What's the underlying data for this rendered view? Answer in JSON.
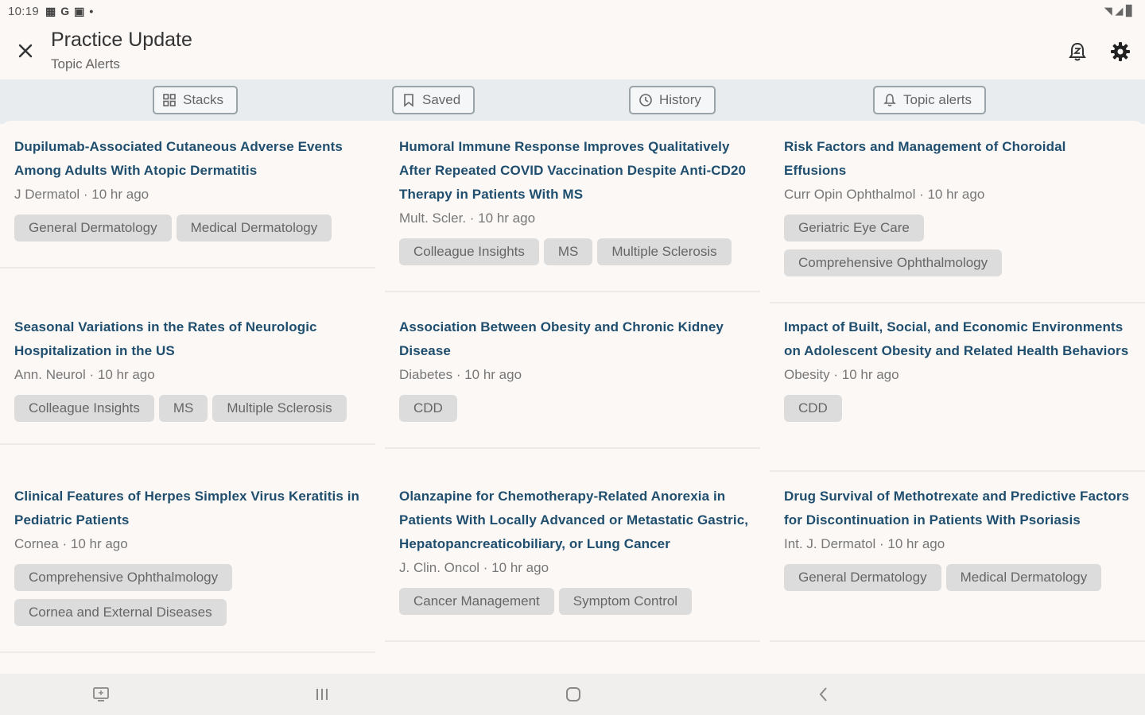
{
  "status_bar": {
    "time": "10:19",
    "icons": [
      "▦",
      "G",
      "▣",
      "•"
    ],
    "right_icons": "◥ ◢ ▊"
  },
  "app_bar": {
    "title": "Practice Update",
    "subtitle": "Topic Alerts",
    "close_icon": "close-icon",
    "bell_icon": "bell-snooze-icon",
    "gear_icon": "gear-icon"
  },
  "tabs": [
    {
      "label": "Stacks",
      "icon": "grid-icon"
    },
    {
      "label": "Saved",
      "icon": "bookmark-icon"
    },
    {
      "label": "History",
      "icon": "clock-icon"
    },
    {
      "label": "Topic alerts",
      "icon": "bell-icon"
    }
  ],
  "articles": {
    "col1": [
      {
        "title": "Dupilumab-Associated Cutaneous Adverse Events Among Adults With Atopic Dermatitis",
        "meta": "J Dermatol · 10 hr ago",
        "tags": [
          "General Dermatology",
          "Medical Dermatology"
        ]
      },
      {
        "title": "Seasonal Variations in the Rates of Neurologic Hospitalization in the US",
        "meta": "Ann. Neurol · 10 hr ago",
        "tags": [
          "Colleague Insights",
          "MS",
          "Multiple Sclerosis"
        ]
      },
      {
        "title": "Clinical Features of Herpes Simplex Virus Keratitis in Pediatric Patients",
        "meta": "Cornea · 10 hr ago",
        "tags": [
          "Comprehensive Ophthalmology",
          "Cornea and External Diseases"
        ]
      }
    ],
    "col2": [
      {
        "title": "Humoral Immune Response Improves Qualitatively After Repeated COVID Vaccination Despite Anti-CD20 Therapy in Patients With MS",
        "meta": "Mult. Scler. · 10 hr ago",
        "tags": [
          "Colleague Insights",
          "MS",
          "Multiple Sclerosis"
        ]
      },
      {
        "title": "Association Between Obesity and Chronic Kidney Disease",
        "meta": "Diabetes · 10 hr ago",
        "tags": [
          "CDD"
        ]
      },
      {
        "title": "Olanzapine for Chemotherapy-Related Anorexia in Patients With Locally Advanced or Metastatic Gastric, Hepatopancreaticobiliary, or Lung Cancer",
        "meta": "J. Clin. Oncol · 10 hr ago",
        "tags": [
          "Cancer Management",
          "Symptom Control"
        ]
      }
    ],
    "col3": [
      {
        "title": "Risk Factors and Management of Choroidal Effusions",
        "meta": "Curr Opin Ophthalmol · 10 hr ago",
        "tags": [
          "Geriatric Eye Care",
          "Comprehensive Ophthalmology"
        ]
      },
      {
        "title": "Impact of Built, Social, and Economic Environments on Adolescent Obesity and Related Health Behaviors",
        "meta": "Obesity · 10 hr ago",
        "tags": [
          "CDD"
        ]
      },
      {
        "title": "Drug Survival of Methotrexate and Predictive Factors for Discontinuation in Patients With Psoriasis",
        "meta": "Int. J. Dermatol · 10 hr ago",
        "tags": [
          "General Dermatology",
          "Medical Dermatology"
        ]
      }
    ]
  },
  "nav_bar": {
    "icons": [
      "screenshot-icon",
      "recents-icon",
      "home-icon",
      "back-icon"
    ]
  },
  "colors": {
    "title_blue": "#1f4e6e",
    "tag_bg": "#dcdcdc",
    "tabbar_bg": "#e8ecee",
    "page_bg": "#fbf8f6"
  }
}
